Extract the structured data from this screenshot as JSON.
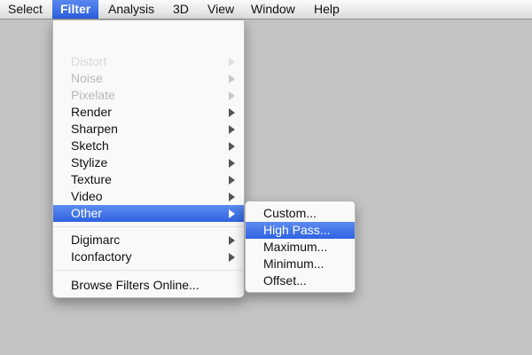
{
  "menubar": {
    "items": [
      "Select",
      "Filter",
      "Analysis",
      "3D",
      "View",
      "Window",
      "Help"
    ],
    "active": "Filter"
  },
  "filter_menu": {
    "items": [
      {
        "label": "Distort",
        "state": "faded",
        "submenu": true
      },
      {
        "label": "Noise",
        "state": "disabled",
        "submenu": true
      },
      {
        "label": "Pixelate",
        "state": "disabled",
        "submenu": true
      },
      {
        "label": "Render",
        "state": "enabled",
        "submenu": true
      },
      {
        "label": "Sharpen",
        "state": "enabled",
        "submenu": true
      },
      {
        "label": "Sketch",
        "state": "enabled",
        "submenu": true
      },
      {
        "label": "Stylize",
        "state": "enabled",
        "submenu": true
      },
      {
        "label": "Texture",
        "state": "enabled",
        "submenu": true
      },
      {
        "label": "Video",
        "state": "enabled",
        "submenu": true
      },
      {
        "label": "Other",
        "state": "highlighted",
        "submenu": true
      },
      {
        "label": "Digimarc",
        "state": "enabled",
        "submenu": true
      },
      {
        "label": "Iconfactory",
        "state": "enabled",
        "submenu": true
      },
      {
        "label": "Browse Filters Online...",
        "state": "enabled",
        "submenu": false
      }
    ]
  },
  "other_submenu": {
    "items": [
      {
        "label": "Custom...",
        "state": "enabled"
      },
      {
        "label": "High Pass...",
        "state": "highlighted"
      },
      {
        "label": "Maximum...",
        "state": "enabled"
      },
      {
        "label": "Minimum...",
        "state": "enabled"
      },
      {
        "label": "Offset...",
        "state": "enabled"
      }
    ]
  },
  "colors": {
    "highlight": "#2f63e2",
    "background": "#c4c4c4"
  }
}
